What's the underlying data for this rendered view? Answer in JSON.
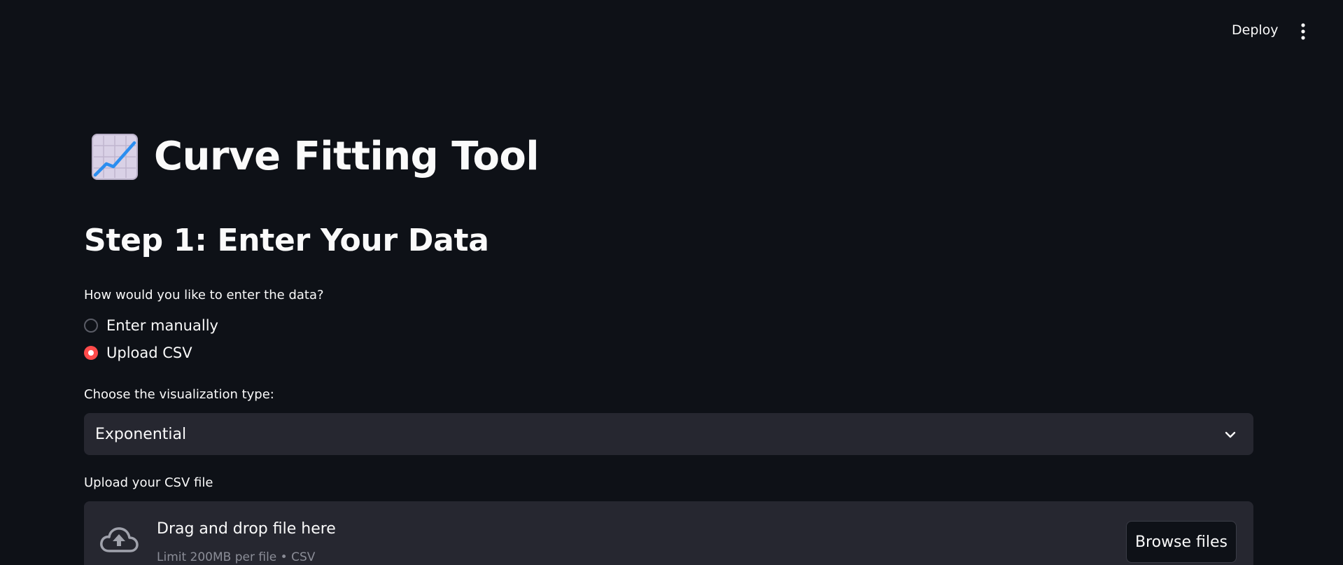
{
  "header": {
    "deploy_label": "Deploy",
    "menu_icon": "vertical-ellipsis-icon"
  },
  "title": {
    "icon": "chart-increasing-icon",
    "text": "Curve Fitting Tool"
  },
  "step1": {
    "heading": "Step 1: Enter Your Data",
    "input_method": {
      "label": "How would you like to enter the data?",
      "options": [
        {
          "label": "Enter manually",
          "selected": false
        },
        {
          "label": "Upload CSV",
          "selected": true
        }
      ]
    },
    "visualization": {
      "label": "Choose the visualization type:",
      "selected": "Exponential"
    },
    "upload": {
      "label": "Upload your CSV file",
      "drop_title": "Drag and drop file here",
      "drop_subtitle": "Limit 200MB per file • CSV",
      "browse_label": "Browse files"
    }
  },
  "colors": {
    "background": "#0e1117",
    "panel": "#262730",
    "accent": "#ff4b4b",
    "text": "#fafafa",
    "muted": "#8b8d97"
  }
}
